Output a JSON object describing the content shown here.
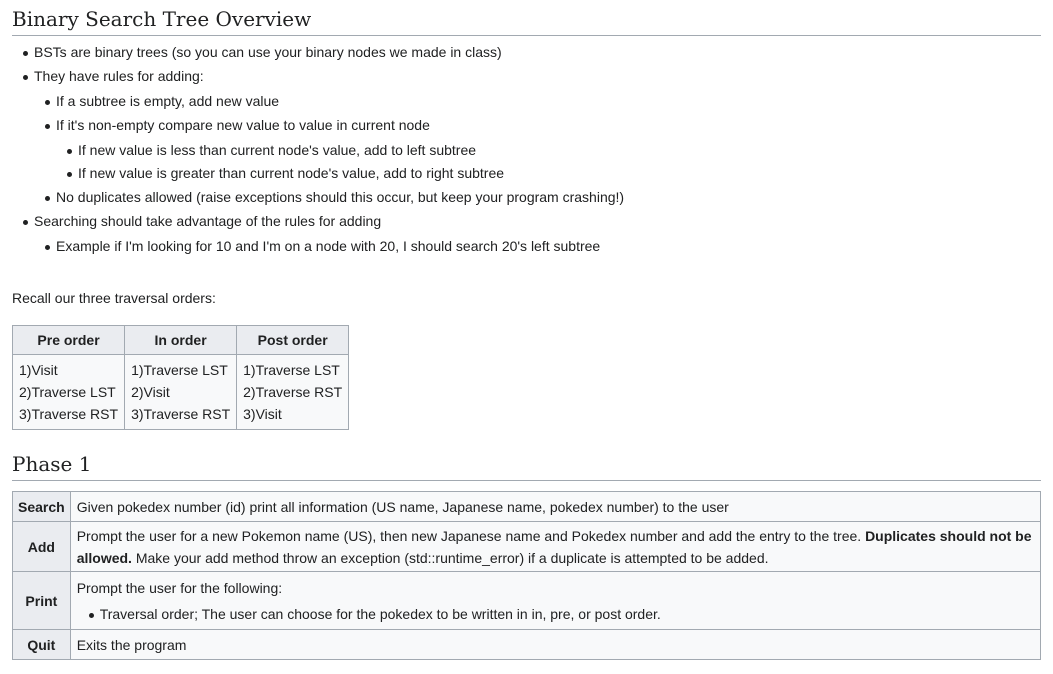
{
  "heading": "Binary Search Tree Overview",
  "bullets": {
    "b1": "BSTs are binary trees (so you can use your binary nodes we made in class)",
    "b2": "They have rules for adding:",
    "b2_1": "If a subtree is empty, add new value",
    "b2_2": "If it's non-empty compare new value to value in current node",
    "b2_2_1": "If new value is less than current node's value, add to left subtree",
    "b2_2_2": "If new value is greater than current node's value, add to right subtree",
    "b2_3": "No duplicates allowed (raise exceptions should this occur, but keep your program crashing!)",
    "b3": "Searching should take advantage of the rules for adding",
    "b3_1": "Example if I'm looking for 10 and I'm on a node with 20, I should search 20's left subtree"
  },
  "recall": "Recall our three traversal orders:",
  "traversal": {
    "headers": [
      "Pre order",
      "In order",
      "Post order"
    ],
    "cols": [
      [
        "1)Visit",
        "2)Traverse LST",
        "3)Traverse RST"
      ],
      [
        "1)Traverse LST",
        "2)Visit",
        "3)Traverse RST"
      ],
      [
        "1)Traverse LST",
        "2)Traverse RST",
        "3)Visit"
      ]
    ]
  },
  "phase_heading": "Phase 1",
  "phase": {
    "search": {
      "label": "Search",
      "text": "Given pokedex number (id) print all information (US name, Japanese name, pokedex number) to the user"
    },
    "add": {
      "label": "Add",
      "text1": "Prompt the user for a new Pokemon name (US), then new Japanese name and Pokedex number and add the entry to the tree. ",
      "bold": "Duplicates should not be allowed.",
      "text2": " Make your add method throw an exception (std::runtime_error) if a duplicate is attempted to be added."
    },
    "print": {
      "label": "Print",
      "text": "Prompt the user for the following:",
      "bullet": "Traversal order; The user can choose for the pokedex to be written in in, pre, or post order."
    },
    "quit": {
      "label": "Quit",
      "text": "Exits the program"
    }
  }
}
